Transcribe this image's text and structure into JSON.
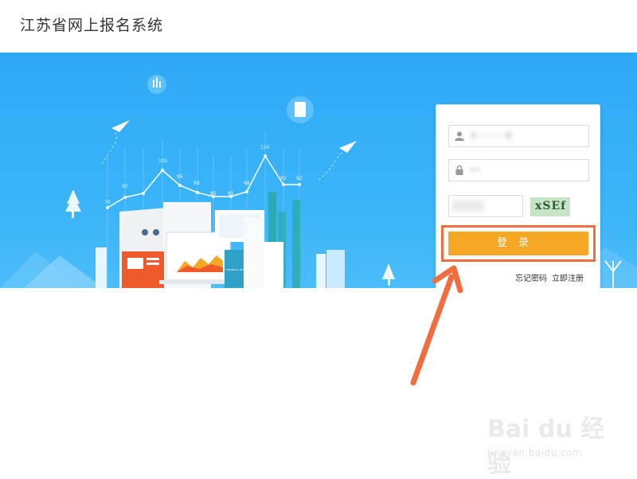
{
  "header": {
    "title": "江苏省网上报名系统"
  },
  "login": {
    "username_value": "3···········0",
    "password_value": "••",
    "captcha_text": "xSEf",
    "submit_label": "登录",
    "forgot_password": "忘记密码",
    "register_now": "立即注册"
  },
  "banner": {
    "chart_values": [
      "70",
      "80",
      "105",
      "95",
      "88",
      "85",
      "85",
      "88",
      "126",
      "92",
      "92"
    ],
    "doc_label": "FINANCIAL REPORT"
  },
  "watermark": {
    "brand": "Bai du 经验",
    "url": "jingyan.baidu.com"
  },
  "colors": {
    "banner": "#2fa9f6",
    "login_button": "#f5a623",
    "highlight": "#f06d3f"
  }
}
